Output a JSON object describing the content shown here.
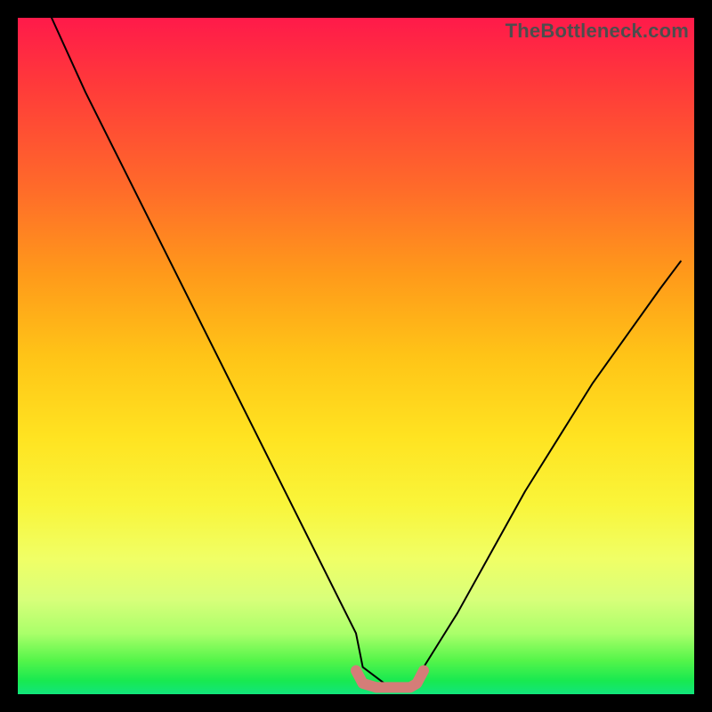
{
  "watermark": "TheBottleneck.com",
  "chart_data": {
    "type": "line",
    "title": "",
    "xlabel": "",
    "ylabel": "",
    "xlim": [
      0,
      100
    ],
    "ylim": [
      0,
      100
    ],
    "series": [
      {
        "name": "bottleneck-curve",
        "color": "#000000",
        "stroke_width": 2,
        "x": [
          5,
          10,
          15,
          20,
          25,
          30,
          35,
          40,
          45,
          50,
          51,
          55,
          58,
          59,
          60,
          65,
          70,
          75,
          80,
          85,
          90,
          95,
          98
        ],
        "y": [
          100,
          89,
          79,
          69,
          59,
          49,
          39,
          29,
          19,
          9,
          4,
          1,
          1,
          1,
          4,
          12,
          21,
          30,
          38,
          46,
          53,
          60,
          64
        ]
      },
      {
        "name": "highlight-segment",
        "color": "#d47d78",
        "stroke_width": 12,
        "x": [
          50,
          51,
          53,
          55,
          57,
          58,
          59,
          60
        ],
        "y": [
          3.5,
          1.6,
          1,
          1,
          1,
          1,
          1.6,
          3.5
        ]
      }
    ]
  },
  "colors": {
    "background": "#000000",
    "gradient_top": "#ff1a4a",
    "gradient_bottom": "#12e57c",
    "curve": "#000000",
    "highlight": "#d47d78",
    "watermark": "#4d4d4d"
  }
}
